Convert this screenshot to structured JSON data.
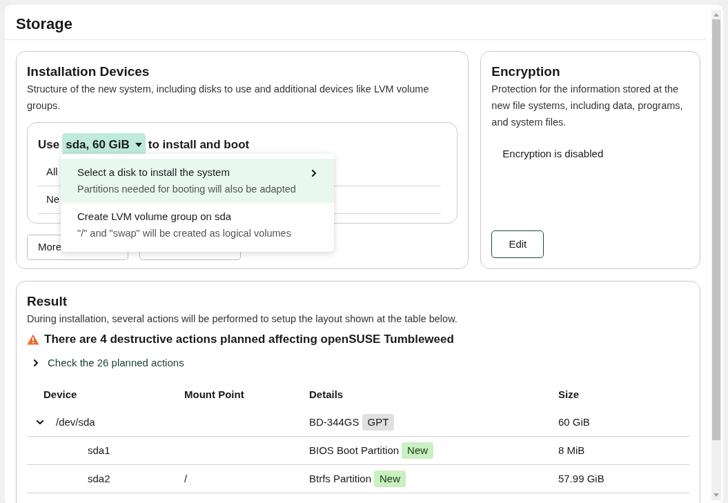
{
  "page": {
    "title": "Storage"
  },
  "devices_card": {
    "title": "Installation Devices",
    "description": "Structure of the new system, including disks to use and additional devices like LVM volume groups.",
    "use_line": {
      "prefix": "Use",
      "disk_button": "sda, 60 GiB",
      "suffix": "to install and boot"
    },
    "covered_rows": [
      "All",
      "Ne"
    ],
    "buttons": [
      {
        "label": "More"
      },
      {
        "covered": true
      }
    ]
  },
  "menu": {
    "items": [
      {
        "title": "Select a disk to install the system",
        "description": "Partitions needed for booting will also be adapted",
        "selected": true,
        "submenu": true
      },
      {
        "title": "Create LVM volume group on sda",
        "description": "\"/\" and \"swap\" will be created as logical volumes",
        "selected": false,
        "submenu": false
      }
    ]
  },
  "encryption_card": {
    "title": "Encryption",
    "description": "Protection for the information stored at the new file systems, including data, programs, and system files.",
    "status": "Encryption is disabled",
    "button": "Edit"
  },
  "result_card": {
    "title": "Result",
    "description": "During installation, several actions will be performed to setup the layout shown at the table below.",
    "warning": "There are 4 destructive actions planned affecting openSUSE Tumbleweed",
    "actions_toggle": {
      "label": "Check the 26 planned actions",
      "expanded": false
    },
    "table": {
      "columns": [
        "Device",
        "Mount Point",
        "Details",
        "Size"
      ],
      "rows": [
        {
          "device": "/dev/sda",
          "details": "BD-344GS",
          "badge": {
            "kind": "neutral",
            "text": "GPT"
          },
          "size": "60 GiB",
          "expanded": true,
          "children": [
            {
              "device": "sda1",
              "details": "BIOS Boot Partition",
              "badge": {
                "kind": "new",
                "text": "New"
              },
              "size": "8 MiB"
            },
            {
              "device": "sda2",
              "mount": "/",
              "details": "Btrfs Partition",
              "badge": {
                "kind": "new",
                "text": "New"
              },
              "size": "57.99 GiB"
            }
          ]
        }
      ]
    }
  }
}
